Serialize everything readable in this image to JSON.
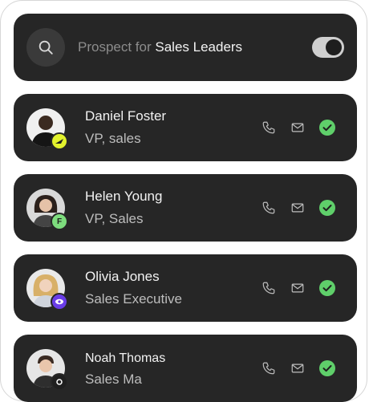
{
  "search": {
    "prefix": "Prospect for ",
    "highlight": "Sales Leaders",
    "toggle_on": true
  },
  "contacts": [
    {
      "name": "Daniel Foster",
      "title": "VP, sales",
      "badge_icon": "airplane-icon",
      "badge_text": "",
      "badge_color": "#e2f22d",
      "status": "verified"
    },
    {
      "name": "Helen Young",
      "title": "VP, Sales",
      "badge_icon": "letter-f-icon",
      "badge_text": "F",
      "badge_color": "#7ddc7d",
      "status": "verified"
    },
    {
      "name": "Olivia Jones",
      "title": "Sales Executive",
      "badge_icon": "eye-icon",
      "badge_text": "",
      "badge_color": "#6a3de8",
      "status": "verified"
    },
    {
      "name": "Noah Thomas",
      "title": "Sales Ma",
      "badge_icon": "company-icon",
      "badge_text": "",
      "badge_color": "#1f1f1f",
      "status": "verified"
    }
  ],
  "colors": {
    "card": "#262626",
    "check": "#5fcf6a",
    "icon": "#bdbdbd"
  }
}
